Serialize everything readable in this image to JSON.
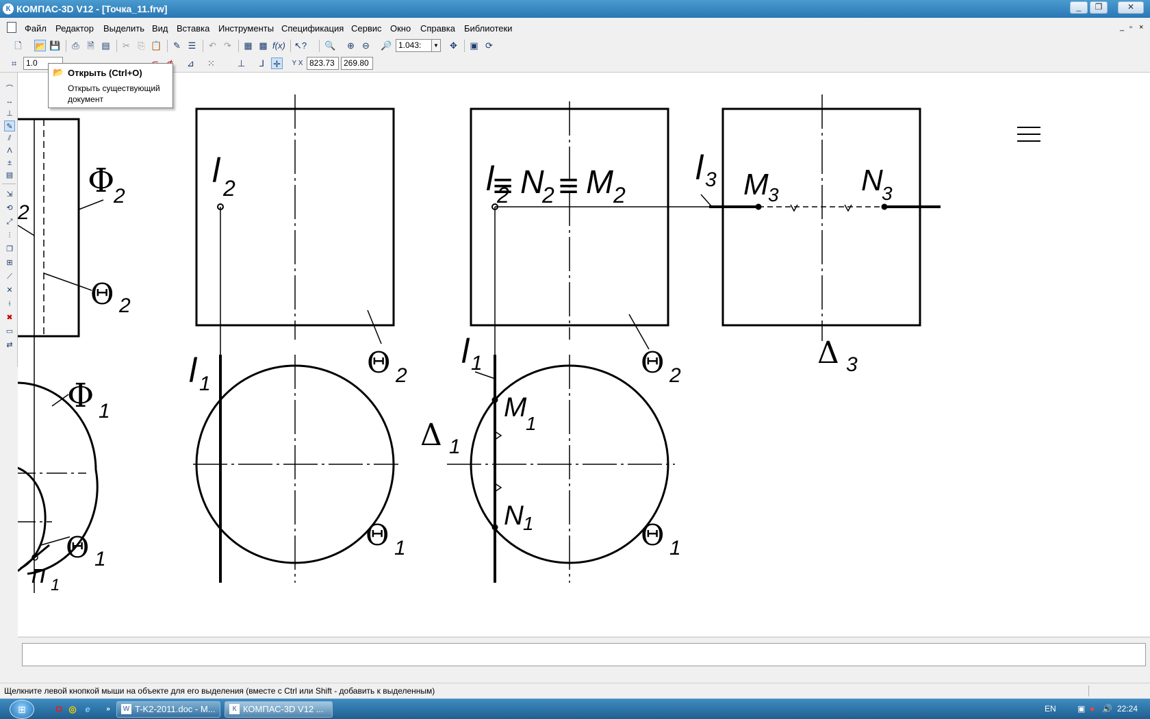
{
  "window": {
    "title": "КОМПАС-3D V12 - [Точка_11.frw]",
    "icon": "kompas-logo-icon",
    "controls": [
      "minimize-icon",
      "restore-icon",
      "close-icon"
    ]
  },
  "menu": {
    "items": [
      "Файл",
      "Редактор",
      "Выделить",
      "Вид",
      "Вставка",
      "Инструменты",
      "Спецификация",
      "Сервис",
      "Окно",
      "Справка",
      "Библиотеки"
    ],
    "mdi_controls": [
      "_",
      "▫",
      "×"
    ]
  },
  "toolbar1": {
    "icons": [
      "new-document-icon",
      "open-document-icon",
      "save-icon",
      "print-icon",
      "preview-icon",
      "cut-icon",
      "copy-icon",
      "paste-icon",
      "undo-icon",
      "redo-icon",
      "fx-icon",
      "help-pointer-icon",
      "zoom-icon",
      "pan-icon"
    ],
    "zoom_value": "1.043:"
  },
  "toolbar2": {
    "step_value": "1.0",
    "coord_x": "823.73",
    "coord_y": "269.80"
  },
  "tooltip": {
    "title": "Открыть (Ctrl+O)",
    "description": "Открыть существующий документ",
    "icon": "open-folder-icon"
  },
  "drawing": {
    "labels": {
      "phi2": "Φ",
      "phi2_sub": "2",
      "theta": "Θ",
      "sub1": "1",
      "sub2": "2",
      "sub3": "3",
      "l": "l",
      "phi1": "Φ",
      "pi": "п",
      "equiv": "≡",
      "N": "N",
      "M": "M",
      "delta": "Δ"
    }
  },
  "status": {
    "hint": "Щелкните левой кнопкой мыши на объекте для его выделения (вместе с Ctrl или Shift - добавить к выделенным)"
  },
  "taskbar": {
    "tasks": [
      {
        "label": "T-K2-2011.doc - M...",
        "icon": "word-doc-icon"
      },
      {
        "label": "КОМПАС-3D V12 ...",
        "icon": "kompas-logo-icon"
      }
    ],
    "lang": "EN",
    "clock": "22:24"
  }
}
